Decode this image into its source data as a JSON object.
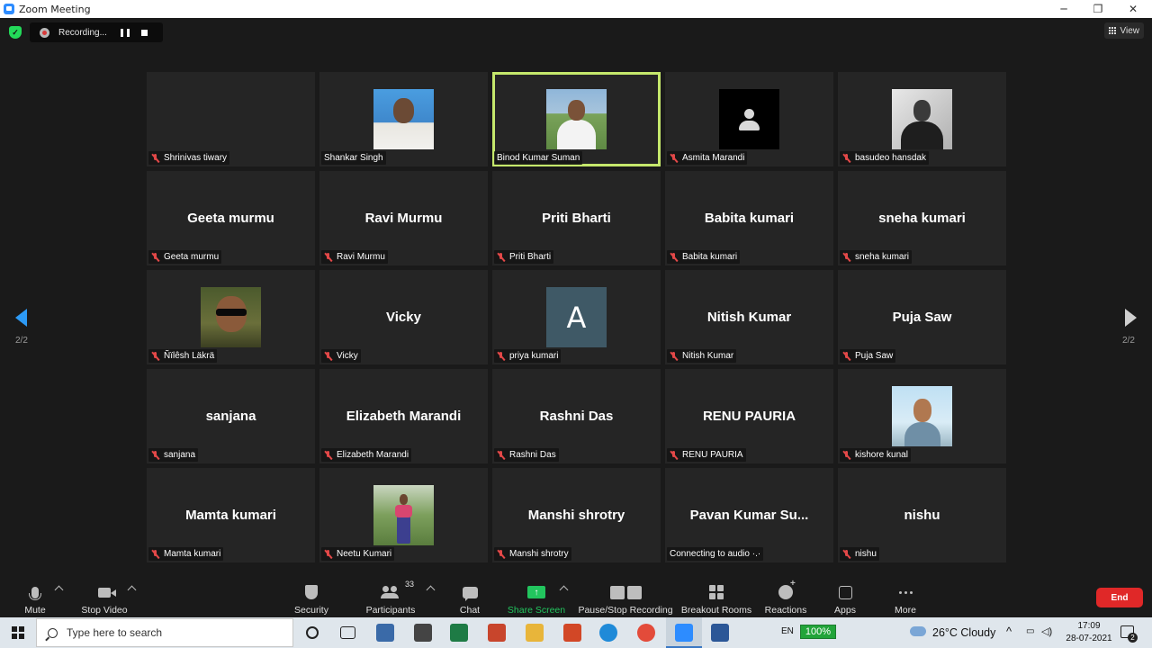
{
  "window": {
    "title": "Zoom Meeting",
    "controls": {
      "minimize": "─",
      "maximize": "❐",
      "close": "✕"
    }
  },
  "topbar": {
    "recording_label": "Recording...",
    "view_label": "View"
  },
  "pagination": {
    "left": "2/2",
    "right": "2/2"
  },
  "participants": [
    {
      "display": "photo-none",
      "big": "",
      "plate": "Shrinivas tiwary",
      "muted": true,
      "active": false
    },
    {
      "display": "photo-blue",
      "big": "",
      "plate": "Shankar Singh",
      "muted": false,
      "active": false
    },
    {
      "display": "photo-field",
      "big": "",
      "plate": "Binod Kumar Suman",
      "muted": false,
      "active": true
    },
    {
      "display": "photo-avatar",
      "big": "",
      "plate": "Asmita Marandi",
      "muted": true,
      "active": false
    },
    {
      "display": "photo-bw",
      "big": "",
      "plate": "basudeo hansdak",
      "muted": true,
      "active": false
    },
    {
      "display": "name",
      "big": "Geeta murmu",
      "plate": "Geeta murmu",
      "muted": true,
      "active": false
    },
    {
      "display": "name",
      "big": "Ravi Murmu",
      "plate": "Ravi Murmu",
      "muted": true,
      "active": false
    },
    {
      "display": "name",
      "big": "Priti Bharti",
      "plate": "Priti Bharti",
      "muted": true,
      "active": false
    },
    {
      "display": "name",
      "big": "Babita kumari",
      "plate": "Babita kumari",
      "muted": true,
      "active": false
    },
    {
      "display": "name",
      "big": "sneha kumari",
      "plate": "sneha kumari",
      "muted": true,
      "active": false
    },
    {
      "display": "photo-dark",
      "big": "",
      "plate": "Ñïlêsh Läkrä",
      "muted": true,
      "active": false
    },
    {
      "display": "name",
      "big": "Vicky",
      "plate": "Vicky",
      "muted": true,
      "active": false
    },
    {
      "display": "letter",
      "big": "A",
      "plate": "priya kumari",
      "muted": true,
      "active": false
    },
    {
      "display": "name",
      "big": "Nitish Kumar",
      "plate": "Nitish Kumar",
      "muted": true,
      "active": false
    },
    {
      "display": "name",
      "big": "Puja Saw",
      "plate": "Puja Saw",
      "muted": true,
      "active": false
    },
    {
      "display": "name",
      "big": "sanjana",
      "plate": "sanjana",
      "muted": true,
      "active": false
    },
    {
      "display": "name",
      "big": "Elizabeth Marandi",
      "plate": "Elizabeth Marandi",
      "muted": true,
      "active": false
    },
    {
      "display": "name",
      "big": "Rashni Das",
      "plate": "Rashni Das",
      "muted": true,
      "active": false
    },
    {
      "display": "name",
      "big": "RENU PAURIA",
      "plate": "RENU PAURIA",
      "muted": true,
      "active": false
    },
    {
      "display": "photo-sky",
      "big": "",
      "plate": "kishore kunal",
      "muted": true,
      "active": false
    },
    {
      "display": "name",
      "big": "Mamta kumari",
      "plate": "Mamta kumari",
      "muted": true,
      "active": false
    },
    {
      "display": "photo-green",
      "big": "",
      "plate": "Neetu Kumari",
      "muted": true,
      "active": false
    },
    {
      "display": "name",
      "big": "Manshi shrotry",
      "plate": "Manshi shrotry",
      "muted": true,
      "active": false
    },
    {
      "display": "name",
      "big": "Pavan Kumar Su...",
      "plate": "Connecting to audio ·.·",
      "muted": false,
      "active": false
    },
    {
      "display": "name",
      "big": "nishu",
      "plate": "nishu",
      "muted": true,
      "active": false
    }
  ],
  "toolbar": {
    "mute": "Mute",
    "stop_video": "Stop Video",
    "security": "Security",
    "participants": "Participants",
    "participants_count": "33",
    "chat": "Chat",
    "share_screen": "Share Screen",
    "recording": "Pause/Stop Recording",
    "breakout": "Breakout Rooms",
    "reactions": "Reactions",
    "apps": "Apps",
    "more": "More",
    "end": "End",
    "colors": {
      "share": "#22c55e",
      "end": "#e02828",
      "active_border": "#c5e86c",
      "nav_arrow": "#2d9af5"
    }
  },
  "taskbar": {
    "search_placeholder": "Type here to search",
    "language": "EN",
    "battery": "100%",
    "weather": "26°C  Cloudy",
    "time": "17:09",
    "date": "28-07-2021",
    "notifications": "2"
  }
}
